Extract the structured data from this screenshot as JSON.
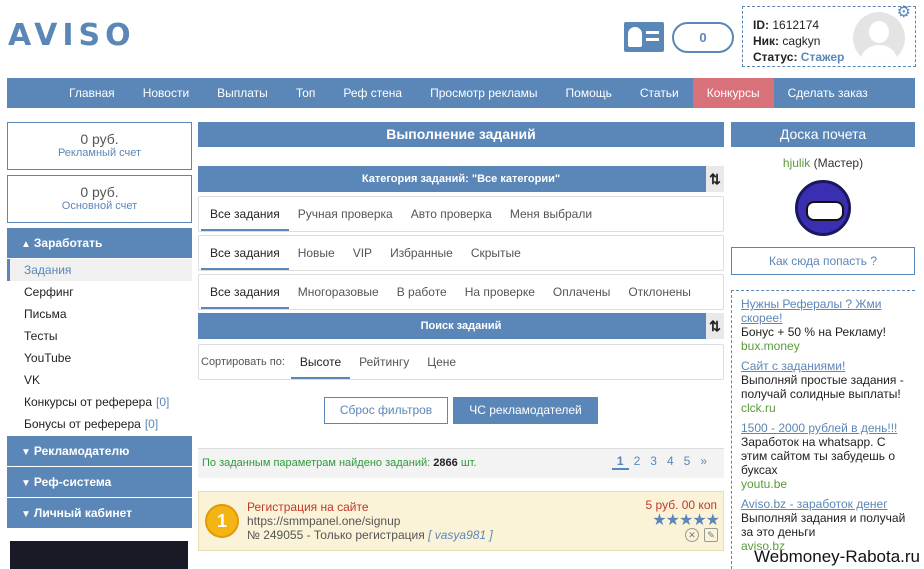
{
  "header": {
    "logo": "AVISO",
    "balance_count": "0",
    "user": {
      "id_label": "ID:",
      "id": "1612174",
      "nick_label": "Ник:",
      "nick": "cagkyn",
      "status_label": "Статус:",
      "status": "Стажер"
    }
  },
  "topnav": [
    "Главная",
    "Новости",
    "Выплаты",
    "Топ",
    "Реф стена",
    "Просмотр рекламы",
    "Помощь",
    "Статьи",
    "Конкурсы",
    "Сделать заказ"
  ],
  "topnav_active": "Конкурсы",
  "accounts": [
    {
      "amount": "0 руб.",
      "label": "Рекламный счет"
    },
    {
      "amount": "0 руб.",
      "label": "Основной счет"
    }
  ],
  "sidebar": {
    "earn": "Заработать",
    "items": [
      {
        "label": "Задания",
        "count": ""
      },
      {
        "label": "Серфинг",
        "count": ""
      },
      {
        "label": "Письма",
        "count": ""
      },
      {
        "label": "Тесты",
        "count": ""
      },
      {
        "label": "YouTube",
        "count": ""
      },
      {
        "label": "VK",
        "count": ""
      },
      {
        "label": "Конкурсы от реферера",
        "count": "[0]"
      },
      {
        "label": "Бонусы от реферера",
        "count": "[0]"
      }
    ],
    "advertiser": "Рекламодателю",
    "ref_system": "Реф-система",
    "cabinet": "Личный кабинет"
  },
  "main": {
    "title": "Выполнение заданий",
    "category_bar": "Категория заданий: \"Все категории\"",
    "tabs1": [
      "Все задания",
      "Ручная проверка",
      "Авто проверка",
      "Меня выбрали"
    ],
    "tabs2": [
      "Все задания",
      "Новые",
      "VIP",
      "Избранные",
      "Скрытые"
    ],
    "tabs3": [
      "Все задания",
      "Многоразовые",
      "В работе",
      "На проверке",
      "Оплачены",
      "Отклонены"
    ],
    "search_bar": "Поиск заданий",
    "sort_label": "Сортировать по:",
    "sort_tabs": [
      "Высоте",
      "Рейтингу",
      "Цене"
    ],
    "reset_button": "Сброс фильтров",
    "blacklist_button": "ЧС рекламодателей",
    "found_text": "По заданным параметрам найдено заданий:",
    "found_count": "2866",
    "found_unit": "шт.",
    "pages": [
      "1",
      "2",
      "3",
      "4",
      "5",
      "»"
    ],
    "task": {
      "rank": "1",
      "title": "Регистрация на сайте",
      "url": "https://smmpanel.one/signup",
      "info": "№ 249055 - Только регистрация",
      "author": "[ vasya981 ]",
      "price": "5 руб. 00 коп",
      "rating_stars": 5
    }
  },
  "right": {
    "title": "Доска почета",
    "honor_name": "hjulik",
    "honor_rank": "(Мастер)",
    "how_button": "Как сюда попасть ?",
    "ads": [
      {
        "title": "Нужны Рефералы ? Жми скорее!",
        "desc": "Бонус + 50 % на Рекламу!",
        "link": "bux.money"
      },
      {
        "title": "Сайт с заданиями!",
        "desc": "Выполняй простые задания - получай солидные выплаты!",
        "link": "clck.ru"
      },
      {
        "title": "1500 - 2000 рублей в день!!!",
        "desc": "Заработок на whatsapp. С этим сайтом ты забудешь о букcах",
        "link": "youtu.be"
      },
      {
        "title": "Aviso.bz - заработок денег",
        "desc": "Выполняй задания и получай за это деньги",
        "link": "aviso.bz"
      }
    ]
  },
  "watermark": "Webmoney-Rabota.ru"
}
